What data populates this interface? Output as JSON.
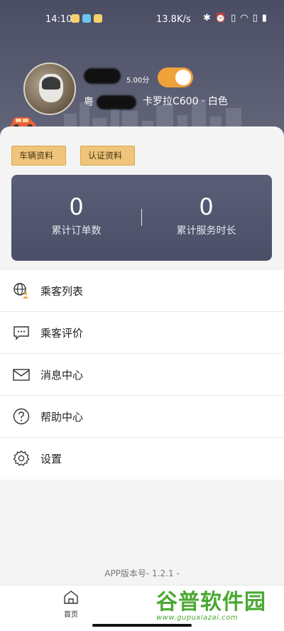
{
  "status_bar": {
    "time": "14:10",
    "net_speed": "13.8K/s",
    "app_icon_colors": [
      "#f7d070",
      "#6cc6f0",
      "#f7d070"
    ]
  },
  "profile": {
    "name_visible_char": "粤",
    "rating": "5.00分",
    "online_toggle": true,
    "car_model": "卡罗拉C600 · 白色",
    "accent_color": "#f0a23a"
  },
  "tags": {
    "vehicle_info": "车辆资料",
    "cert_info": "认证资料"
  },
  "stats": [
    {
      "value": "0",
      "label": "累计订单数"
    },
    {
      "value": "0",
      "label": "累计服务时长"
    }
  ],
  "menu": [
    {
      "label": "乘客列表",
      "icon": "globe-person-icon"
    },
    {
      "label": "乘客评价",
      "icon": "chat-bubble-icon"
    },
    {
      "label": "消息中心",
      "icon": "envelope-icon"
    },
    {
      "label": "帮助中心",
      "icon": "question-circle-icon"
    },
    {
      "label": "设置",
      "icon": "gear-icon"
    }
  ],
  "version": "APP版本号- 1.2.1 -",
  "tabbar": {
    "home_label": "首页"
  },
  "watermark": {
    "logo_text": "谷普软件园",
    "url": "www.gupuxiazai.com"
  }
}
